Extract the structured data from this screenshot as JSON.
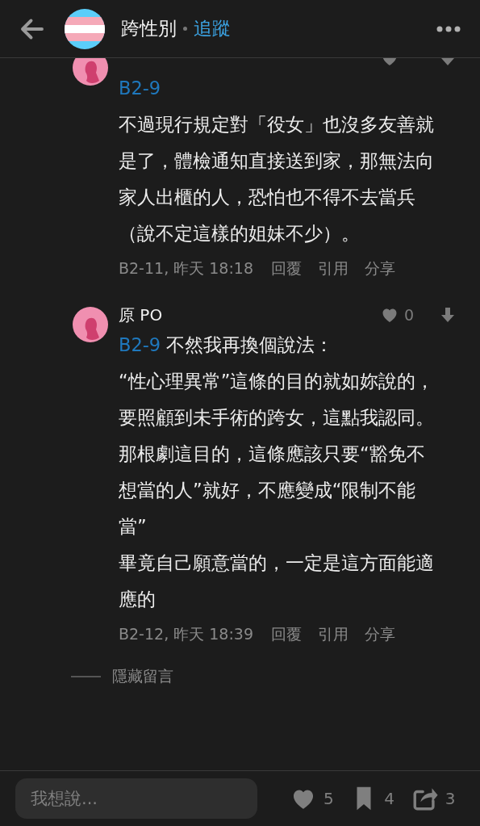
{
  "header": {
    "title": "跨性別",
    "follow": "追蹤"
  },
  "comments": [
    {
      "reply_to": "B2-9",
      "reply_inline": false,
      "paragraphs": [
        "不過現行規定對「役女」也沒多友善就是了，體檢通知直接送到家，那無法向家人出櫃的人，恐怕也不得不去當兵（說不定這樣的姐妹不少）。"
      ],
      "meta": "B2-11, 昨天 18:18",
      "actions": [
        "回覆",
        "引用",
        "分享"
      ]
    },
    {
      "author": "原 PO",
      "likes": "0",
      "reply_to": "B2-9",
      "reply_inline": true,
      "paragraphs": [
        "不然我再換個說法：",
        "“性心理異常”這條的目的就如妳說的，要照顧到未手術的跨女，這點我認同。",
        "那根劇這目的，這條應該只要“豁免不想當的人”就好，不應變成“限制不能當”",
        "畢竟自己願意當的，一定是這方面能適應的"
      ],
      "meta": "B2-12, 昨天 18:39",
      "actions": [
        "回覆",
        "引用",
        "分享"
      ]
    }
  ],
  "hidden_comments": "隱藏留言",
  "bottom_bar": {
    "placeholder": "我想說...",
    "likes": "5",
    "bookmarks": "4",
    "shares": "3"
  }
}
